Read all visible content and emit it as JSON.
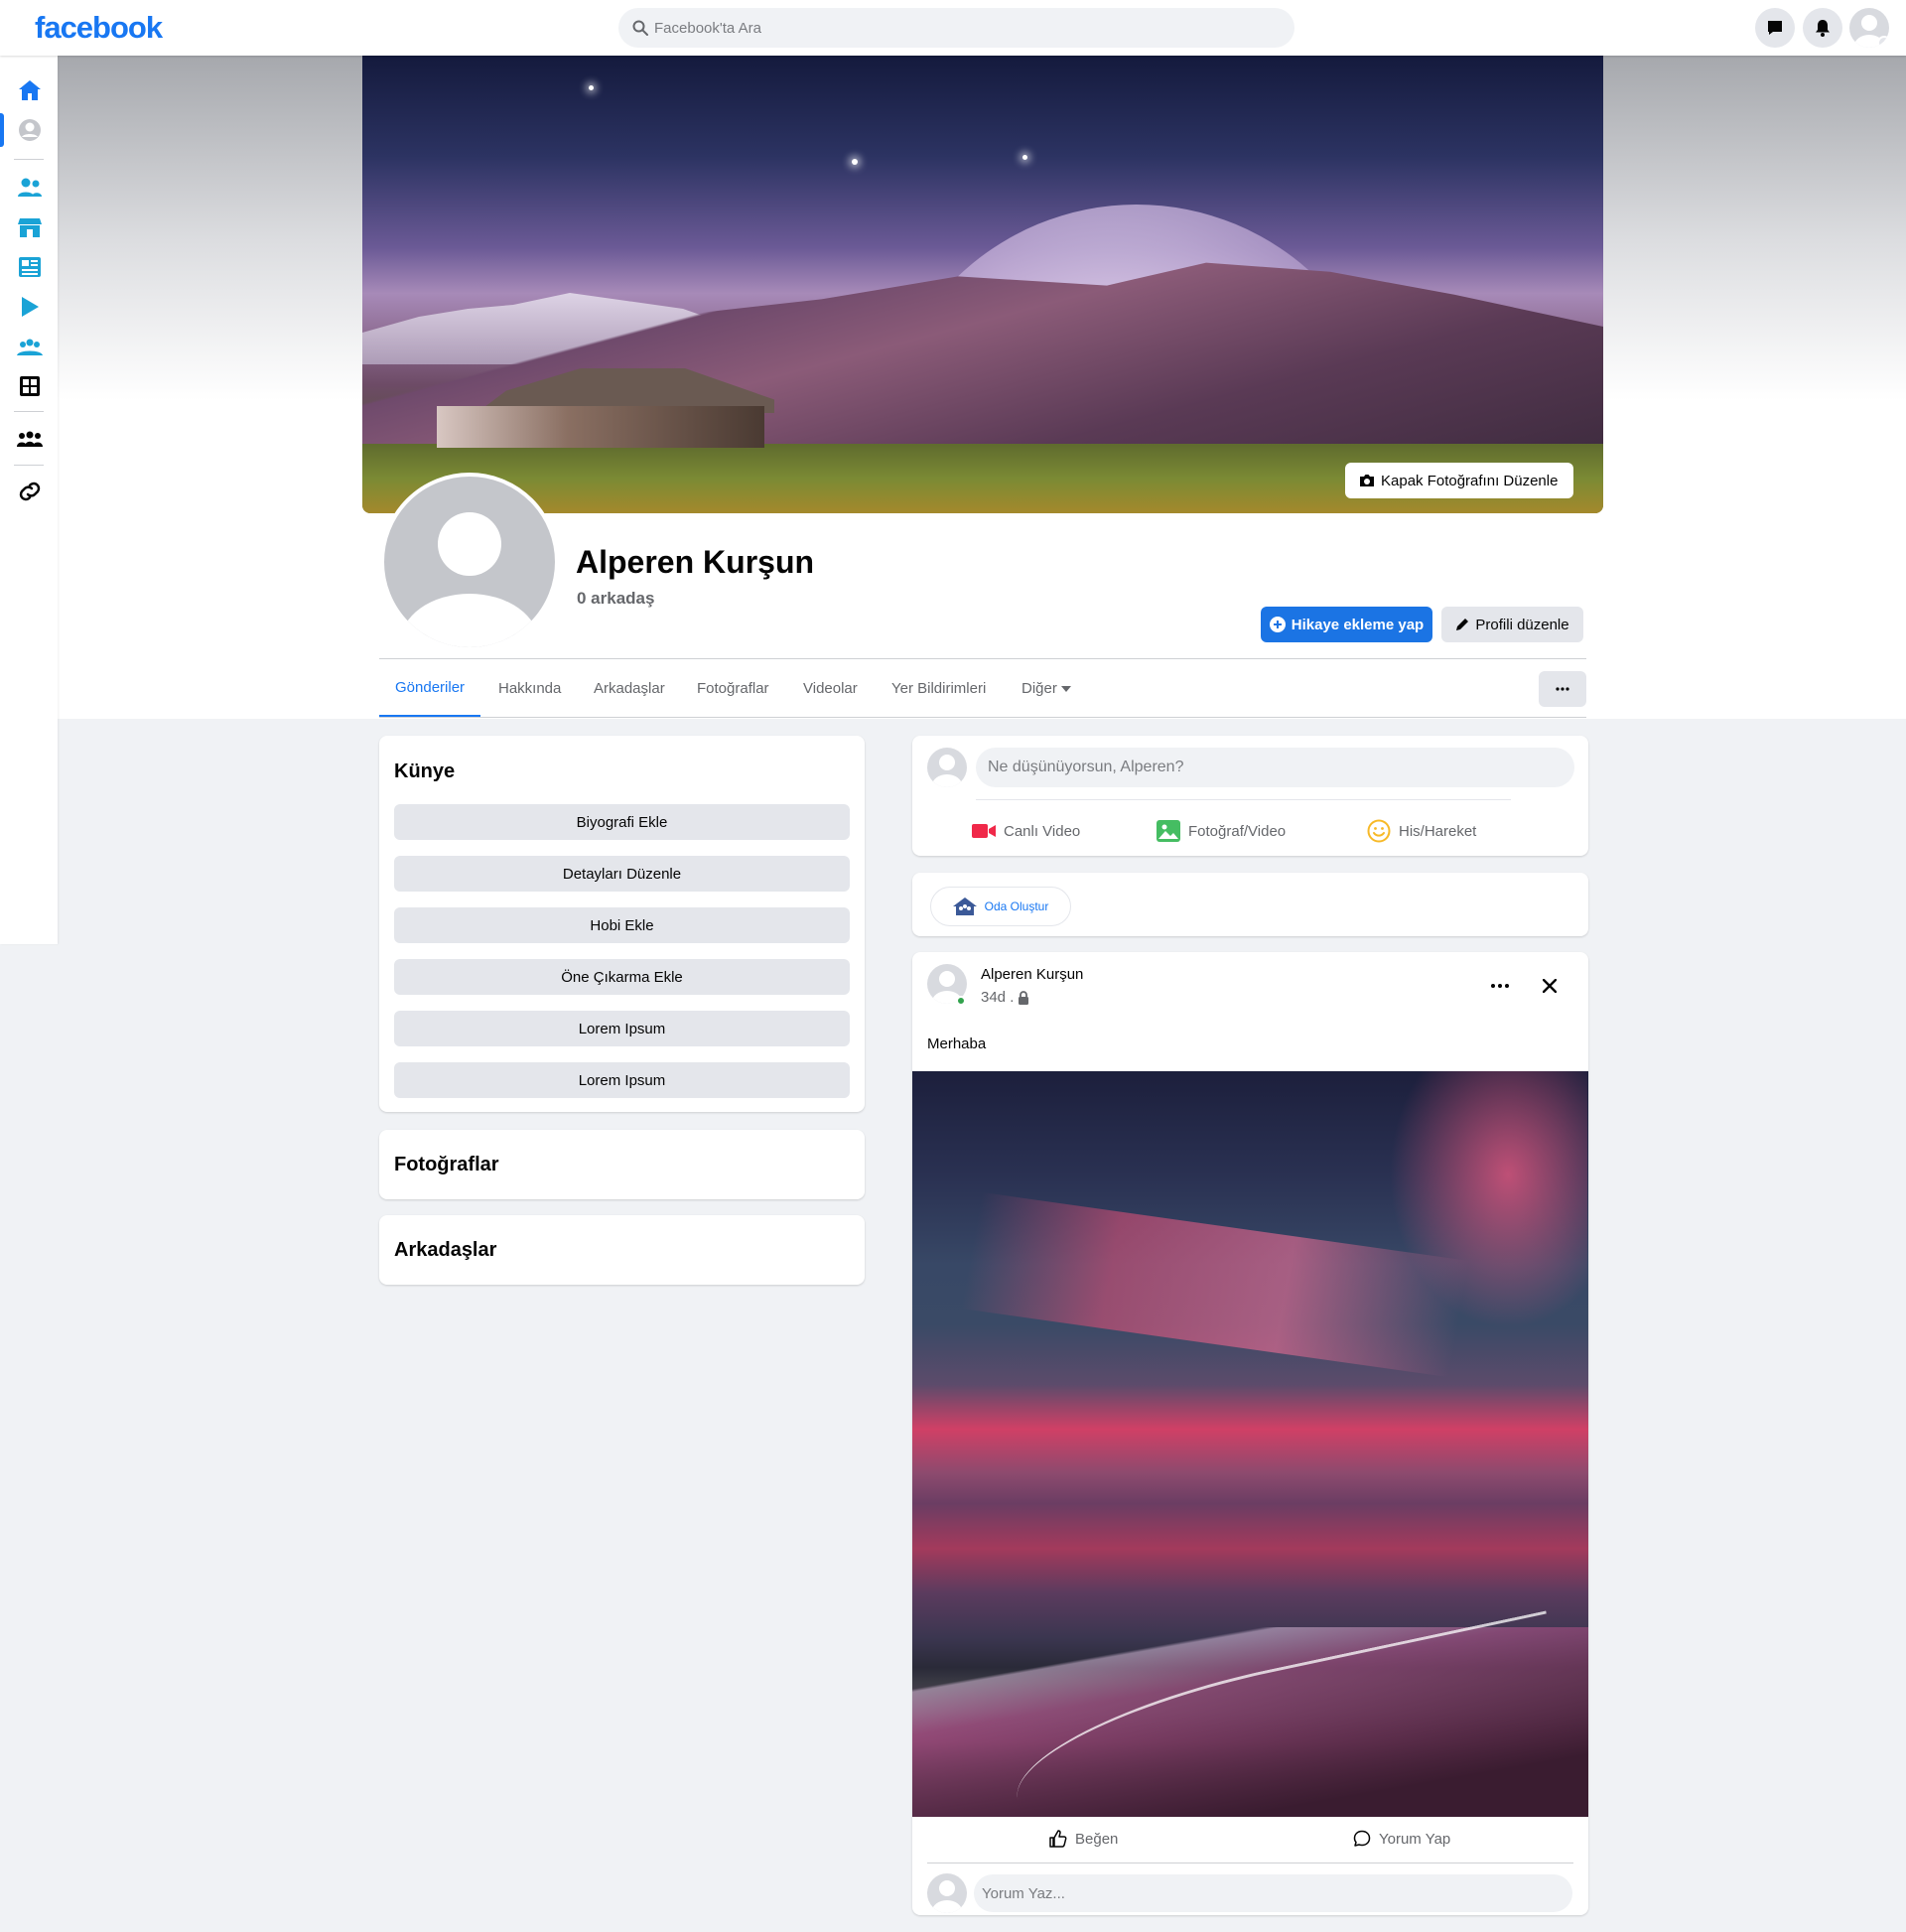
{
  "brand": {
    "logo": "facebook",
    "color": "#1877f2"
  },
  "search": {
    "placeholder": "Facebook'ta Ara"
  },
  "topbar": {
    "icons": [
      "messenger-icon",
      "bell-icon",
      "avatar"
    ]
  },
  "leftrail": {
    "icons": [
      "home-icon",
      "profile-icon",
      "friends-icon",
      "marketplace-icon",
      "news-icon",
      "watch-icon",
      "groups-icon",
      "apps-icon",
      "community-icon",
      "link-icon"
    ]
  },
  "cover": {
    "edit_label": "Kapak Fotoğrafını Düzenle"
  },
  "profile": {
    "name": "Alperen Kurşun",
    "friends": "0 arkadaş",
    "story_button": "Hikaye ekleme yap",
    "edit_button": "Profili düzenle"
  },
  "tabs": [
    {
      "label": "Gönderiler",
      "active": true
    },
    {
      "label": "Hakkında"
    },
    {
      "label": "Arkadaşlar"
    },
    {
      "label": "Fotoğraflar"
    },
    {
      "label": "Videolar"
    },
    {
      "label": "Yer Bildirimleri"
    },
    {
      "label": "Diğer"
    }
  ],
  "intro": {
    "title": "Künye",
    "buttons": [
      "Biyografi Ekle",
      "Detayları Düzenle",
      "Hobi Ekle",
      "Öne Çıkarma Ekle",
      "Lorem Ipsum",
      "Lorem Ipsum"
    ]
  },
  "photos_card": {
    "title": "Fotoğraflar"
  },
  "friends_card": {
    "title": "Arkadaşlar"
  },
  "composer": {
    "placeholder": "Ne düşünüyorsun, Alperen?",
    "actions": [
      "Canlı Video",
      "Fotoğraf/Video",
      "His/Hareket"
    ]
  },
  "room": {
    "label": "Oda Oluştur"
  },
  "post": {
    "author": "Alperen Kurşun",
    "time": "34d .",
    "text": "Merhaba",
    "like": "Beğen",
    "comment": "Yorum Yap",
    "comment_placeholder": "Yorum Yaz..."
  }
}
